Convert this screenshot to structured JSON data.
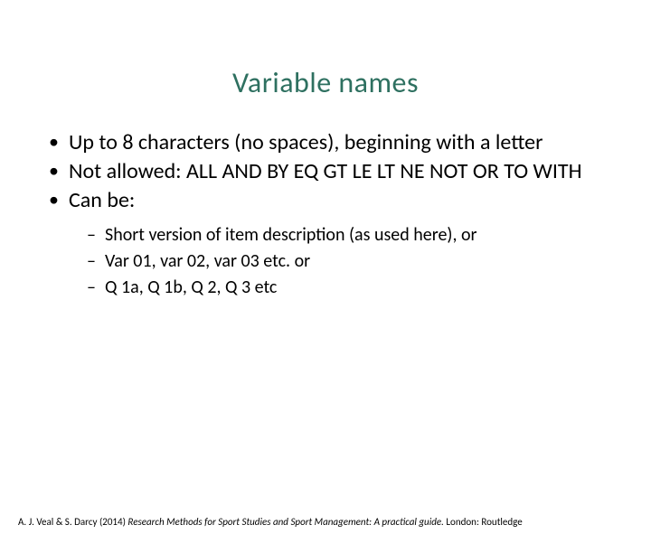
{
  "title": "Variable names",
  "bullets": [
    "Up to 8 characters (no spaces), beginning with a letter",
    "Not allowed:  ALL  AND  BY  EQ  GT  LE  LT  NE  NOT  OR  TO  WITH",
    "Can be:"
  ],
  "subbullets": [
    "Short version of item description (as used here), or",
    "Var 01, var 02, var 03 etc. or",
    "Q 1a, Q 1b, Q 2, Q 3 etc"
  ],
  "footer": {
    "authors_year": "A. J. Veal & S. Darcy (2014) ",
    "title_italic": "Research Methods for Sport Studies and Sport Management: A practical guide. ",
    "rest": "London: Routledge"
  }
}
